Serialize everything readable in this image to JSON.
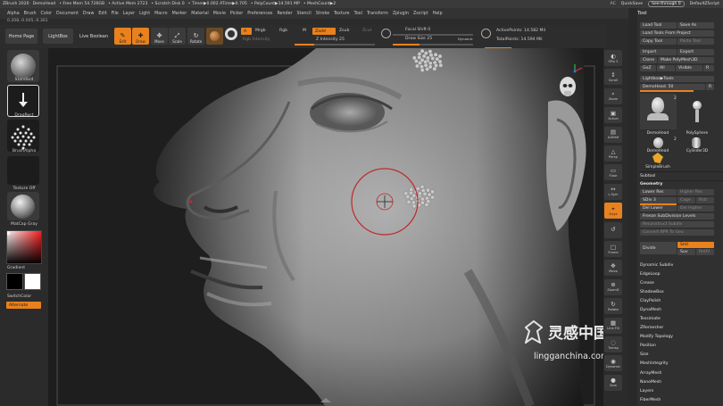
{
  "titlebar": {
    "items": [
      "ZBrush 2020",
      "DemoHead",
      "• Free Mem 54.726GB",
      "• Active Mem 2723",
      "• Scratch Disk 0",
      "• Timer▶0.002 ATime▶0.705",
      "• PolyCount▶14.591 MP",
      "• MeshCount▶2"
    ],
    "ac": "AC",
    "quicksave": "QuickSave",
    "seethrough": "See-through  0",
    "menus": "DefaultZScript"
  },
  "menubar": [
    "Alpha",
    "Brush",
    "Color",
    "Document",
    "Draw",
    "Edit",
    "File",
    "Layer",
    "Light",
    "Macro",
    "Marker",
    "Material",
    "Movie",
    "Picker",
    "Preferences",
    "Render",
    "Stencil",
    "Stroke",
    "Texture",
    "Tool",
    "Transform",
    "Zplugin",
    "Zscript",
    "Help"
  ],
  "coords": "0.208,-0.005,-0.361",
  "shelf": {
    "home": "Home Page",
    "lightbox": "LightBox",
    "live_boolean": "Live Boolean",
    "tools": [
      {
        "label": "Edit",
        "icon": "edit-icon",
        "glyph": "✎",
        "on": true
      },
      {
        "label": "Draw",
        "icon": "draw-icon",
        "glyph": "✚",
        "on": true
      },
      {
        "label": "Move",
        "icon": "move-icon",
        "glyph": "✥",
        "on": false
      },
      {
        "label": "Scale",
        "icon": "scale-icon",
        "glyph": "⤢",
        "on": false
      },
      {
        "label": "Rotate",
        "icon": "rotate-icon",
        "glyph": "↻",
        "on": false
      }
    ],
    "a": "A",
    "mrgb": "Mrgb",
    "rgb": "Rgb",
    "m": "M",
    "zadd": "Zadd",
    "zsub": "Zsub",
    "zcut": "Zcut",
    "rgb_intensity": "Rgb Intensity",
    "z_intensity": "Z Intensity 25",
    "focal_shift": "Focal Shift 0",
    "draw_size": "Draw Size 25",
    "dynamic": "Dynamic",
    "active_points": "ActivePoints: 14.582 Mil",
    "total_points": "TotalPoints: 14.594 Mil"
  },
  "lefttray": {
    "brush": "Standard",
    "stroke": "DragRect",
    "alpha": "BrushAlpha",
    "texture": "Texture Off",
    "material": "MatCap Gray",
    "gradient": "Gradient",
    "switch_color": "SwitchColor",
    "alternate": "Alternate"
  },
  "rstrip": [
    {
      "label": "SPix 3",
      "icon": "bpr-icon",
      "glyph": "◐",
      "on": false
    },
    {
      "label": "Scroll",
      "icon": "scroll-icon",
      "glyph": "↕",
      "on": false
    },
    {
      "label": "Zoom",
      "icon": "zoom-icon",
      "glyph": "⌕",
      "on": false
    },
    {
      "label": "Actual",
      "icon": "actual-icon",
      "glyph": "▣",
      "on": false
    },
    {
      "label": "AAHalf",
      "icon": "aahalf-icon",
      "glyph": "▤",
      "on": false
    },
    {
      "label": "Persp",
      "icon": "persp-icon",
      "glyph": "△",
      "on": false
    },
    {
      "label": "Floor",
      "icon": "floor-icon",
      "glyph": "▭",
      "on": false
    },
    {
      "label": "L.Sym",
      "icon": "lsym-icon",
      "glyph": "↔",
      "on": false
    },
    {
      "label": "Gxyz",
      "icon": "xyz-icon",
      "glyph": "⌖",
      "on": true
    },
    {
      "label": "",
      "icon": "rotate-y-icon",
      "glyph": "↺",
      "on": false
    },
    {
      "label": "Frame",
      "icon": "frame-icon",
      "glyph": "□",
      "on": false
    },
    {
      "label": "Move",
      "icon": "move-view-icon",
      "glyph": "✥",
      "on": false
    },
    {
      "label": "ZoomD",
      "icon": "zoom3d-icon",
      "glyph": "⊕",
      "on": false
    },
    {
      "label": "Rotate",
      "icon": "rotate-view-icon",
      "glyph": "↻",
      "on": false
    },
    {
      "label": "Line Fill",
      "icon": "linefill-icon",
      "glyph": "▦",
      "on": false
    },
    {
      "label": "Transp",
      "icon": "transp-icon",
      "glyph": "◌",
      "on": false
    },
    {
      "label": "Dynamic",
      "icon": "dynamic-icon",
      "glyph": "◉",
      "on": false
    },
    {
      "label": "Solo",
      "icon": "solo-icon",
      "glyph": "●",
      "on": false
    }
  ],
  "palette": {
    "title": "Tool",
    "buttons_row1": [
      "Load Tool",
      "Save As"
    ],
    "load_project": "Load Tools From Project",
    "buttons_row2": [
      "Copy Tool",
      "Paste Tool"
    ],
    "buttons_row3": [
      "Import",
      "Export"
    ],
    "buttons_row4": [
      "Clone",
      "Make PolyMesh3D"
    ],
    "buttons_row5": [
      "GoZ",
      "All",
      "Visible",
      "R"
    ],
    "lightbox_tools": "Lightbox▶Tools",
    "demohead_slider": "DemoHead. 50",
    "r_label": "R",
    "subtools": [
      {
        "name": "DemoHead",
        "count": "2"
      },
      {
        "name": "PolySphere",
        "count": ""
      },
      {
        "name": "DemoHead",
        "count": "2"
      },
      {
        "name": "Cylinder3D",
        "count": ""
      },
      {
        "name": "SimpleBrush",
        "count": ""
      }
    ],
    "subtool": "Subtool",
    "geometry": "Geometry",
    "lower_res": "Lower Res",
    "higher_res": "Higher Res",
    "sdiv": "SDiv 3",
    "cage": "Cage",
    "rstr": "Rstr",
    "del_lower": "Del Lower",
    "del_higher": "Del Higher",
    "freeze": "Freeze SubDivision Levels",
    "reconstruct": "Reconstruct Subdiv",
    "convert_bpr": "Convert BPR To Geo",
    "divide": "Divide",
    "smt": "Smt",
    "suv": "Suv",
    "reuv": "ReUV",
    "list": [
      "Dynamic Subdiv",
      "EdgeLoop",
      "Crease",
      "ShadowBox",
      "ClayPolish",
      "DynaMesh",
      "Tessimate",
      "ZRemesher",
      "Modify Topology",
      "Position",
      "Size",
      "MeshIntegrity"
    ],
    "list2": [
      "ArrayMesh",
      "NanoMesh",
      "Layers",
      "FiberMesh"
    ]
  },
  "watermark": {
    "cn": "灵感中国",
    "url": "lingganchina.com"
  },
  "colors": {
    "accent": "#e8811e",
    "panel": "#303030",
    "viewport_bg": "#1e1e1e",
    "cursor_ring": "#c0282a"
  }
}
